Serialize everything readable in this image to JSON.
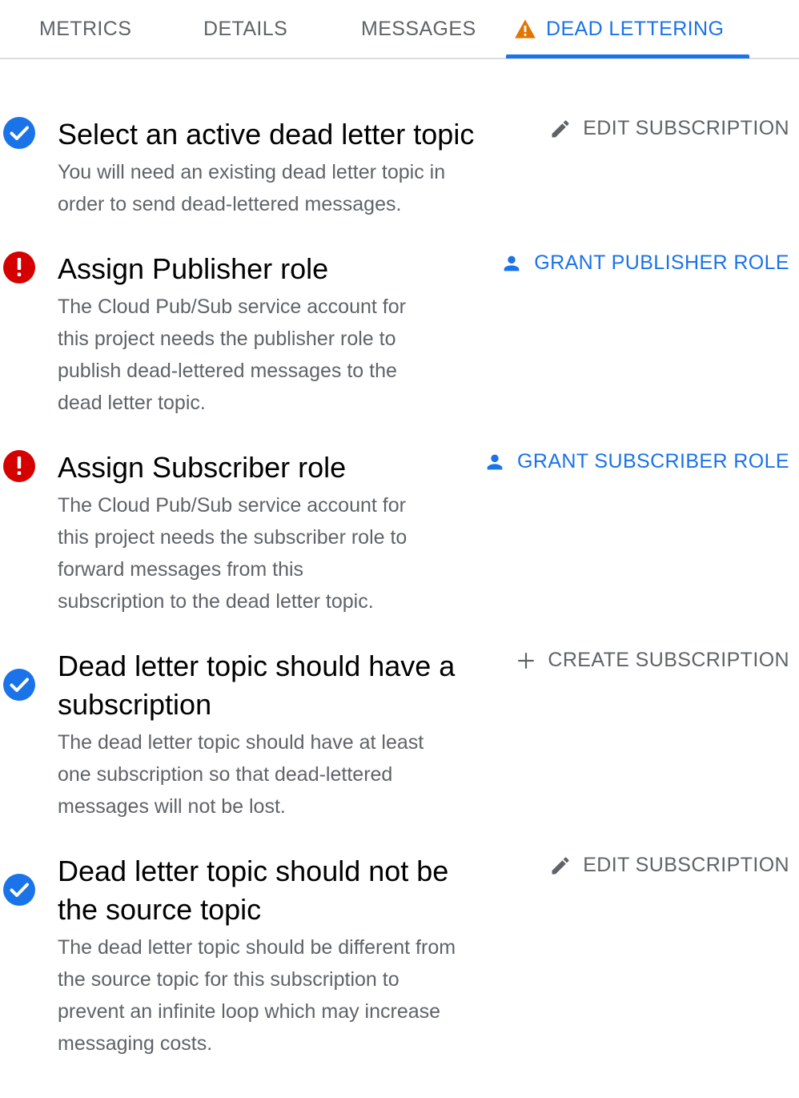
{
  "tabs": [
    {
      "label": "METRICS"
    },
    {
      "label": "DETAILS"
    },
    {
      "label": "MESSAGES"
    },
    {
      "label": "DEAD LETTERING",
      "icon": "warning-icon",
      "active": true
    }
  ],
  "colors": {
    "accent": "#1a73e8",
    "success": "#1a73e8",
    "error": "#d50000",
    "warning": "#e37400",
    "muted": "#5f6368"
  },
  "checklist": [
    {
      "status": "success",
      "title": "Select an active dead letter topic",
      "description": [
        "You will need an existing dead letter topic in",
        "order to send dead-lettered messages."
      ],
      "action": {
        "label": "EDIT SUBSCRIPTION",
        "icon": "pencil-icon"
      }
    },
    {
      "status": "error",
      "title": "Assign Publisher role",
      "description": [
        "The Cloud Pub/Sub service account for",
        "this project needs the publisher role to",
        "publish dead-lettered messages to the",
        "dead letter topic."
      ],
      "action": {
        "label": "GRANT PUBLISHER ROLE",
        "icon": "person-icon"
      }
    },
    {
      "status": "error",
      "title": "Assign Subscriber role",
      "description": [
        "The Cloud Pub/Sub service account for",
        "this project needs the subscriber role to",
        "forward messages from this",
        "subscription to the dead letter topic."
      ],
      "action": {
        "label": "GRANT SUBSCRIBER ROLE",
        "icon": "person-icon"
      }
    },
    {
      "status": "success",
      "title": [
        "Dead letter topic should have a",
        "subscription"
      ],
      "description": [
        "The dead letter topic should have at least",
        "one subscription so that dead-lettered",
        "messages will not be lost."
      ],
      "action": {
        "label": "CREATE SUBSCRIPTION",
        "icon": "plus-icon"
      }
    },
    {
      "status": "success",
      "title": [
        "Dead letter topic should not be",
        "the source topic"
      ],
      "description": [
        "The dead letter topic should be different from",
        "the source topic for this subscription to",
        "prevent an infinite loop which may increase",
        "messaging costs."
      ],
      "action": {
        "label": "EDIT SUBSCRIPTION",
        "icon": "pencil-icon"
      }
    }
  ]
}
